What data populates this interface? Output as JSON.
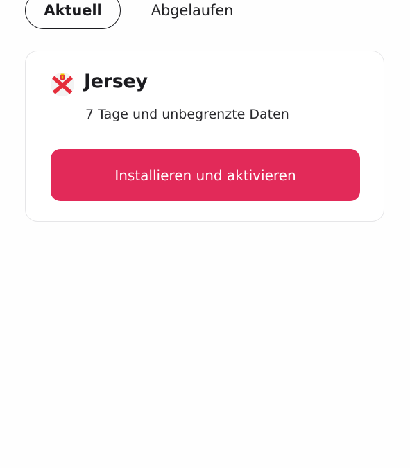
{
  "tabs": {
    "current": "Aktuell",
    "expired": "Abgelaufen"
  },
  "esim_card": {
    "country": "Jersey",
    "flag_icon": "jersey-flag-icon",
    "plan": "7 Tage und unbegrenzte Daten",
    "button_label": "Installieren und aktivieren",
    "button_color": "#e22a59"
  }
}
